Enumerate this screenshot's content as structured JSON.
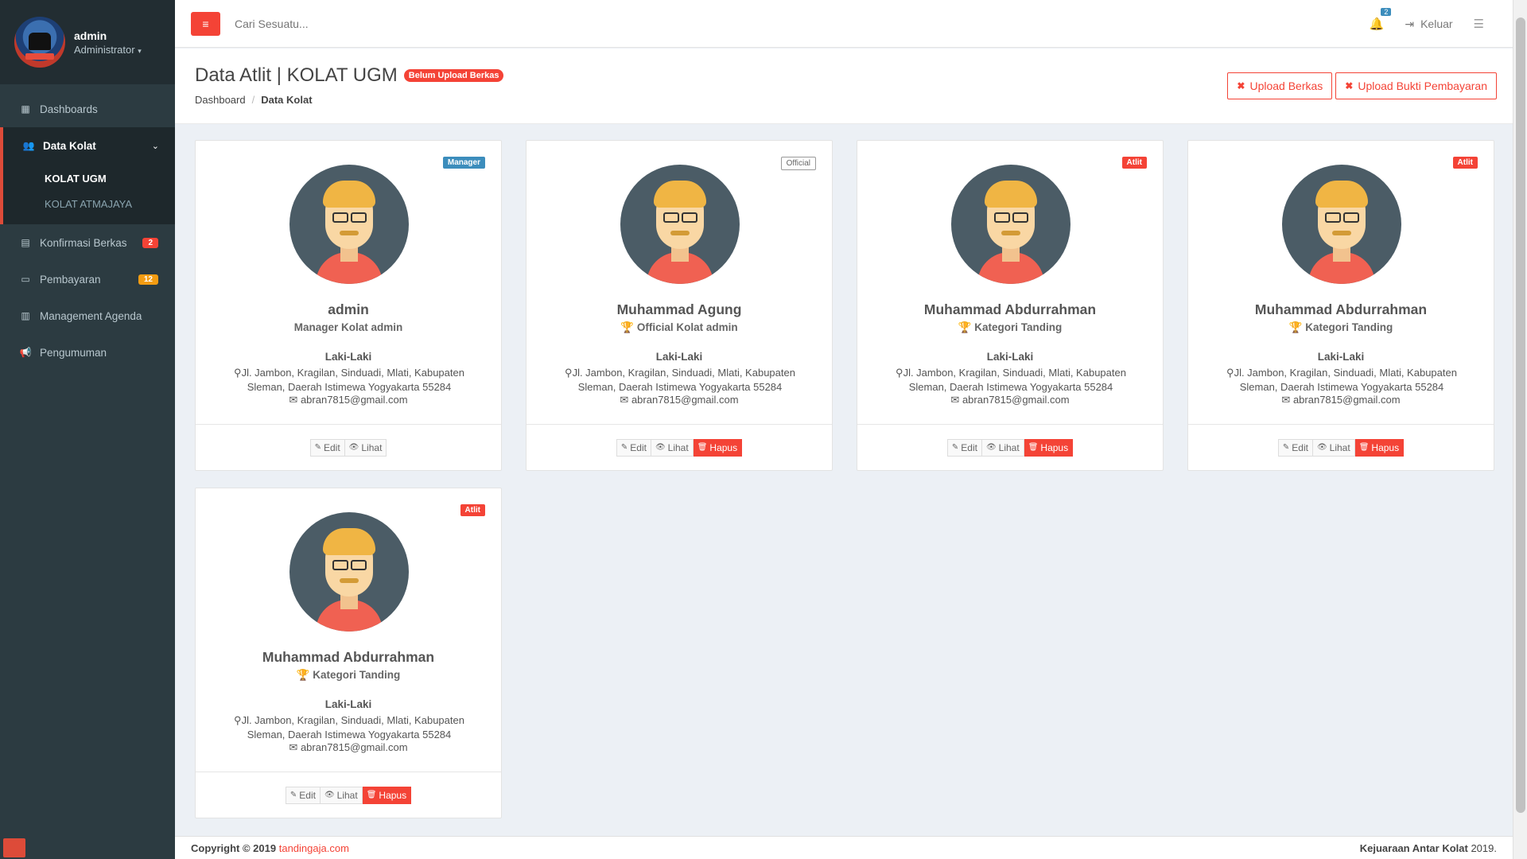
{
  "user": {
    "name": "admin",
    "role": "Administrator"
  },
  "sidebar": {
    "items": [
      {
        "label": "Dashboards"
      },
      {
        "label": "Data Kolat",
        "children": [
          {
            "label": "KOLAT UGM"
          },
          {
            "label": "KOLAT ATMAJAYA"
          }
        ]
      },
      {
        "label": "Konfirmasi Berkas",
        "badge": "2",
        "badge_color": "#f44336"
      },
      {
        "label": "Pembayaran",
        "badge": "12",
        "badge_color": "#f39c12"
      },
      {
        "label": "Management Agenda"
      },
      {
        "label": "Pengumuman"
      }
    ]
  },
  "topbar": {
    "search_placeholder": "Cari Sesuatu...",
    "notif_count": "2",
    "logout_label": "Keluar"
  },
  "header": {
    "title": "Data Atlit | KOLAT UGM",
    "status_label": "Belum Upload Berkas",
    "breadcrumb": [
      "Dashboard",
      "Data Kolat"
    ],
    "buttons": {
      "upload_berkas": "Upload Berkas",
      "upload_bukti": "Upload Bukti Pembayaran"
    }
  },
  "cards": [
    {
      "badge": "Manager",
      "badge_color": "#3c8dbc",
      "name": "admin",
      "subtitle": "Manager Kolat admin",
      "subtitle_icon": "",
      "gender": "Laki-Laki",
      "address": "Jl. Jambon, Kragilan, Sinduadi, Mlati, Kabupaten Sleman, Daerah Istimewa Yogyakarta 55284",
      "email": "abran7815@gmail.com",
      "actions": [
        "Edit",
        "Lihat"
      ]
    },
    {
      "badge": "Official",
      "badge_color": "#ffffff",
      "name": "Muhammad Agung",
      "subtitle": "Official Kolat admin",
      "subtitle_icon": "trophy-icon",
      "gender": "Laki-Laki",
      "address": "Jl. Jambon, Kragilan, Sinduadi, Mlati, Kabupaten Sleman, Daerah Istimewa Yogyakarta 55284",
      "email": "abran7815@gmail.com",
      "actions": [
        "Edit",
        "Lihat",
        "Hapus"
      ]
    },
    {
      "badge": "Atlit",
      "badge_color": "#f44336",
      "name": "Muhammad Abdurrahman",
      "subtitle": "Kategori Tanding",
      "subtitle_icon": "trophy-icon",
      "gender": "Laki-Laki",
      "address": "Jl. Jambon, Kragilan, Sinduadi, Mlati, Kabupaten Sleman, Daerah Istimewa Yogyakarta 55284",
      "email": "abran7815@gmail.com",
      "actions": [
        "Edit",
        "Lihat",
        "Hapus"
      ]
    },
    {
      "badge": "Atlit",
      "badge_color": "#f44336",
      "name": "Muhammad Abdurrahman",
      "subtitle": "Kategori Tanding",
      "subtitle_icon": "trophy-icon",
      "gender": "Laki-Laki",
      "address": "Jl. Jambon, Kragilan, Sinduadi, Mlati, Kabupaten Sleman, Daerah Istimewa Yogyakarta 55284",
      "email": "abran7815@gmail.com",
      "actions": [
        "Edit",
        "Lihat",
        "Hapus"
      ]
    },
    {
      "badge": "Atlit",
      "badge_color": "#f44336",
      "name": "Muhammad Abdurrahman",
      "subtitle": "Kategori Tanding",
      "subtitle_icon": "trophy-icon",
      "gender": "Laki-Laki",
      "address": "Jl. Jambon, Kragilan, Sinduadi, Mlati, Kabupaten Sleman, Daerah Istimewa Yogyakarta 55284",
      "email": "abran7815@gmail.com",
      "actions": [
        "Edit",
        "Lihat",
        "Hapus"
      ]
    }
  ],
  "footer": {
    "copyright": "Copyright © 2019",
    "link": "tandingaja.com",
    "right": "Kejuaraan Antar Kolat",
    "right_year": "2019."
  },
  "colors": {
    "accent": "#f44336",
    "sidebar_bg": "#2c3b41",
    "sidebar_dark": "#222d32",
    "info": "#3c8dbc",
    "warning": "#f39c12"
  }
}
